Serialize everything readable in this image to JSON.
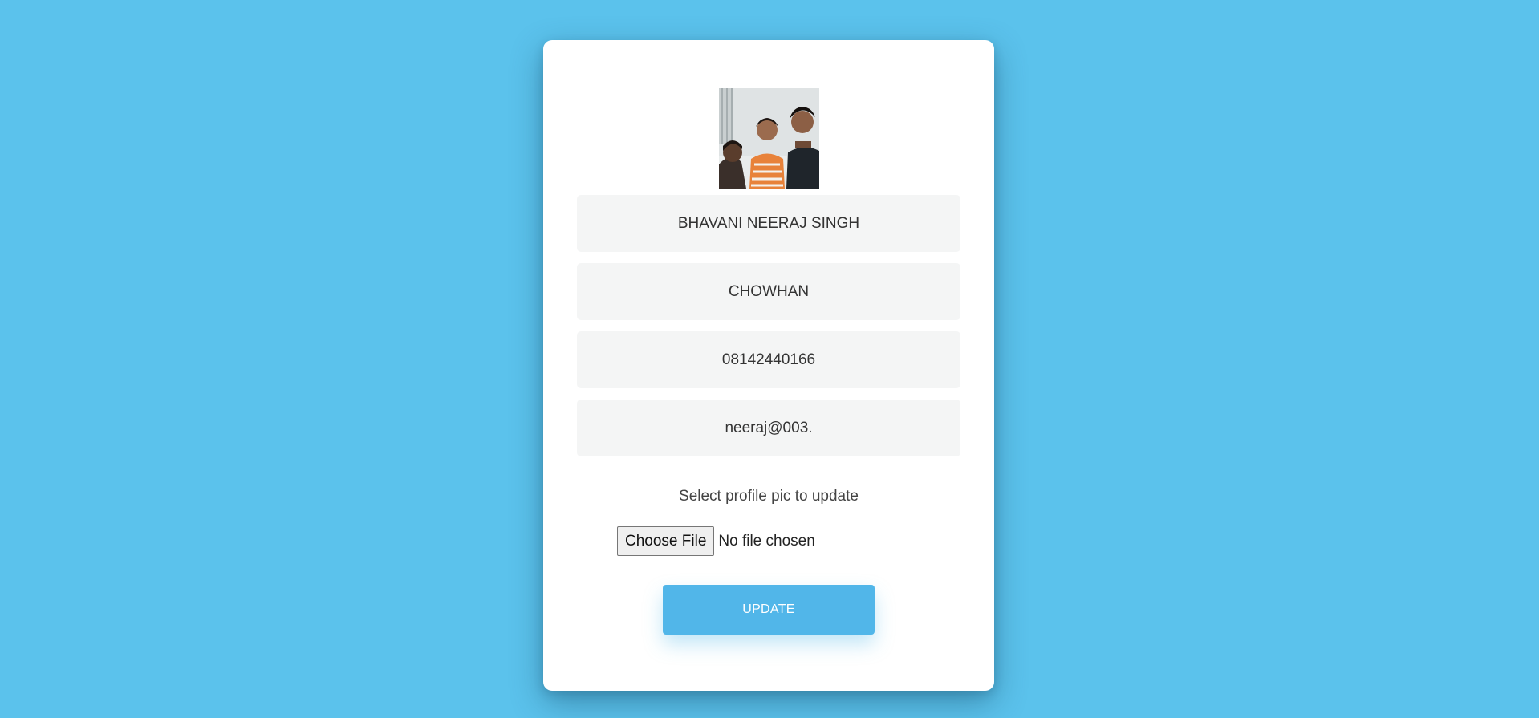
{
  "profile": {
    "avatar_alt": "profile picture",
    "first_name": "BHAVANI NEERAJ SINGH",
    "last_name": "CHOWHAN",
    "phone": "08142440166",
    "password": "neeraj@003."
  },
  "upload": {
    "label": "Select profile pic to update",
    "choose_file_label": "Choose File",
    "file_status": "No file chosen"
  },
  "actions": {
    "update_label": "UPDATE"
  },
  "colors": {
    "background": "#5bc2ec",
    "card": "#ffffff",
    "field": "#f4f5f5",
    "button": "#51b6e9"
  }
}
